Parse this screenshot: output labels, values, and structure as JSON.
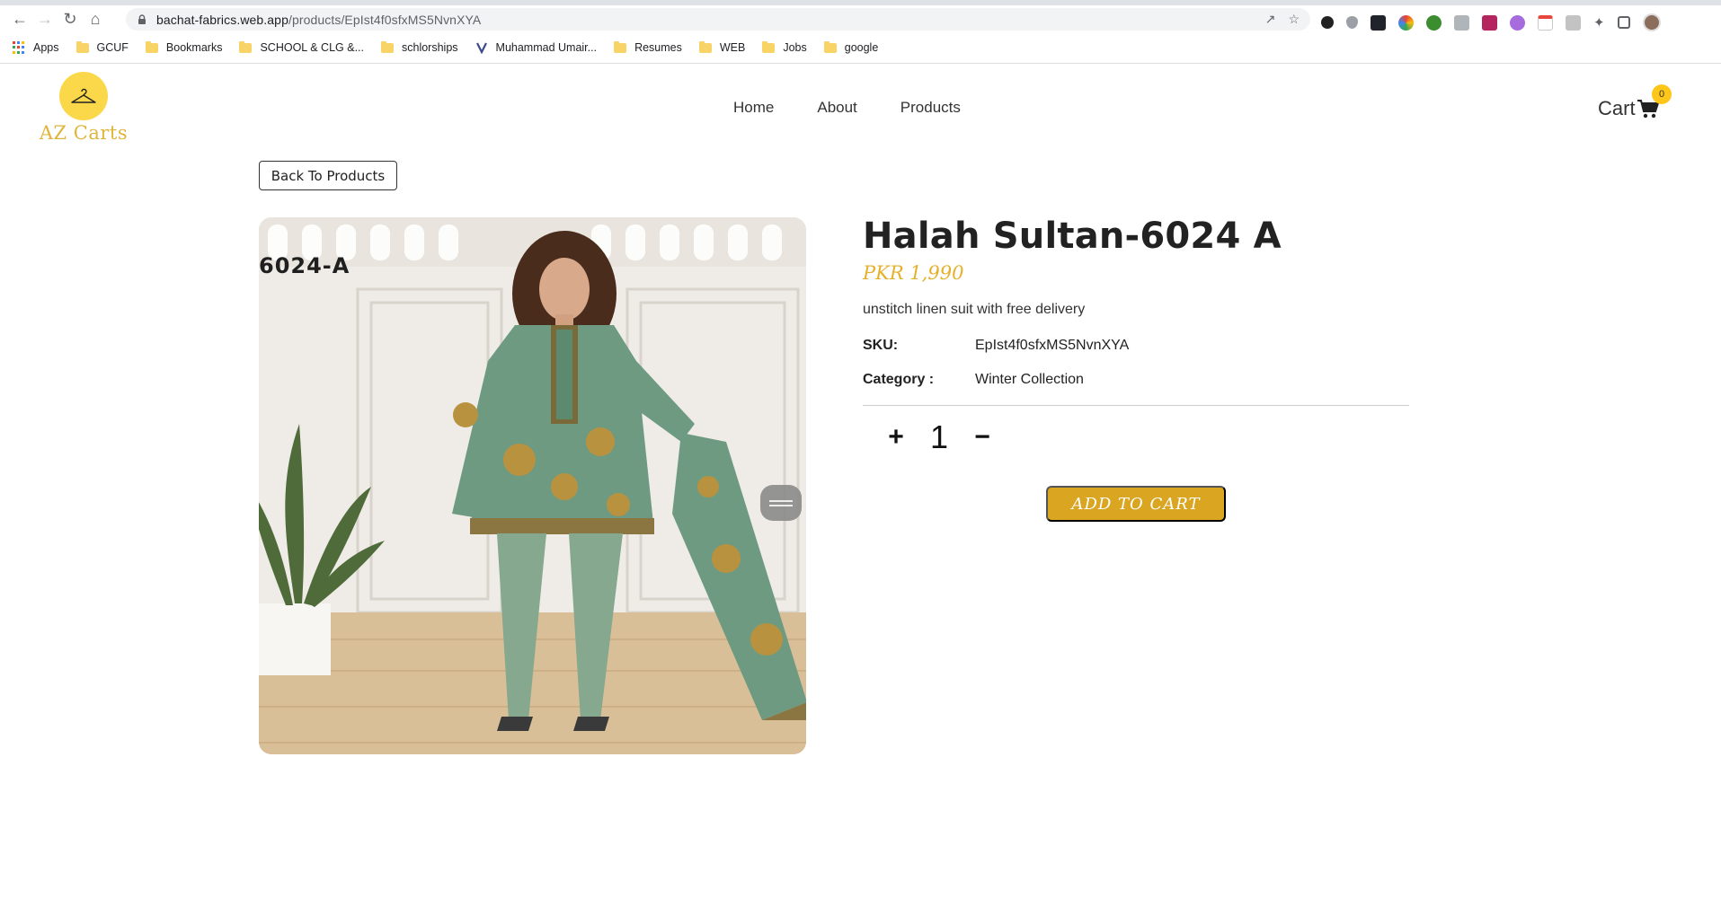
{
  "browser": {
    "url_host": "bachat-fabrics.web.app",
    "url_path": "/products/EpIst4f0sfxMS5NvnXYA",
    "bookmarks": [
      {
        "label": "Apps",
        "kind": "apps"
      },
      {
        "label": "GCUF",
        "kind": "folder"
      },
      {
        "label": "Bookmarks",
        "kind": "folder"
      },
      {
        "label": "SCHOOL & CLG &...",
        "kind": "folder"
      },
      {
        "label": "schlorships",
        "kind": "folder"
      },
      {
        "label": "Muhammad Umair...",
        "kind": "site"
      },
      {
        "label": "Resumes",
        "kind": "folder"
      },
      {
        "label": "WEB",
        "kind": "folder"
      },
      {
        "label": "Jobs",
        "kind": "folder"
      },
      {
        "label": "google",
        "kind": "folder"
      }
    ]
  },
  "site": {
    "logo_text": "AZ Carts",
    "nav": [
      "Home",
      "About",
      "Products"
    ],
    "cart_label": "Cart",
    "cart_count": "0",
    "accent_color": "#daa520"
  },
  "product": {
    "back_label": "Back To Products",
    "image_code": "6024-A",
    "title": "Halah Sultan-6024 A",
    "price": "PKR 1,990",
    "description": "unstitch linen suit with free delivery",
    "sku_label": "SKU:",
    "sku_value": "EpIst4f0sfxMS5NvnXYA",
    "category_label": "Category :",
    "category_value": "Winter Collection",
    "qty_plus": "+",
    "qty_value": "1",
    "qty_minus": "−",
    "add_to_cart": "ADD TO CART"
  }
}
